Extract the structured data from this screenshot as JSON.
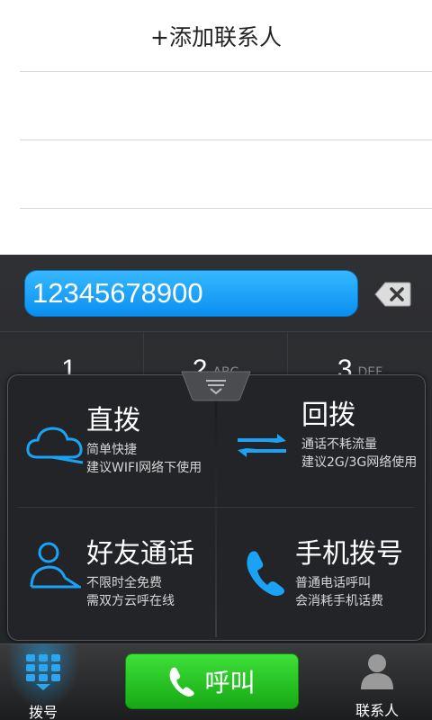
{
  "list": {
    "add_contact": "+添加联系人"
  },
  "dialer": {
    "number": "12345678900",
    "keys": [
      {
        "digit": "1",
        "letters": ""
      },
      {
        "digit": "2",
        "letters": "ABC"
      },
      {
        "digit": "3",
        "letters": "DEF"
      }
    ]
  },
  "options": [
    {
      "title": "直拨",
      "desc1": "简单快捷",
      "desc2": "建议WIFI网络下使用",
      "icon": "cloud-icon"
    },
    {
      "title": "回拨",
      "desc1": "通话不耗流量",
      "desc2": "建议2G/3G网络使用",
      "icon": "swap-arrows-icon"
    },
    {
      "title": "好友通话",
      "desc1": "不限时全免费",
      "desc2": "需双方云呼在线",
      "icon": "person-icon"
    },
    {
      "title": "手机拨号",
      "desc1": "普通电话呼叫",
      "desc2": "会消耗手机话费",
      "icon": "phone-icon"
    }
  ],
  "tabbar": {
    "dial_label": "拨号",
    "call_label": "呼叫",
    "contacts_label": "联系人"
  },
  "colors": {
    "accent_blue": "#1aa3f5",
    "call_green": "#22c21f",
    "panel_bg": "#232427"
  }
}
